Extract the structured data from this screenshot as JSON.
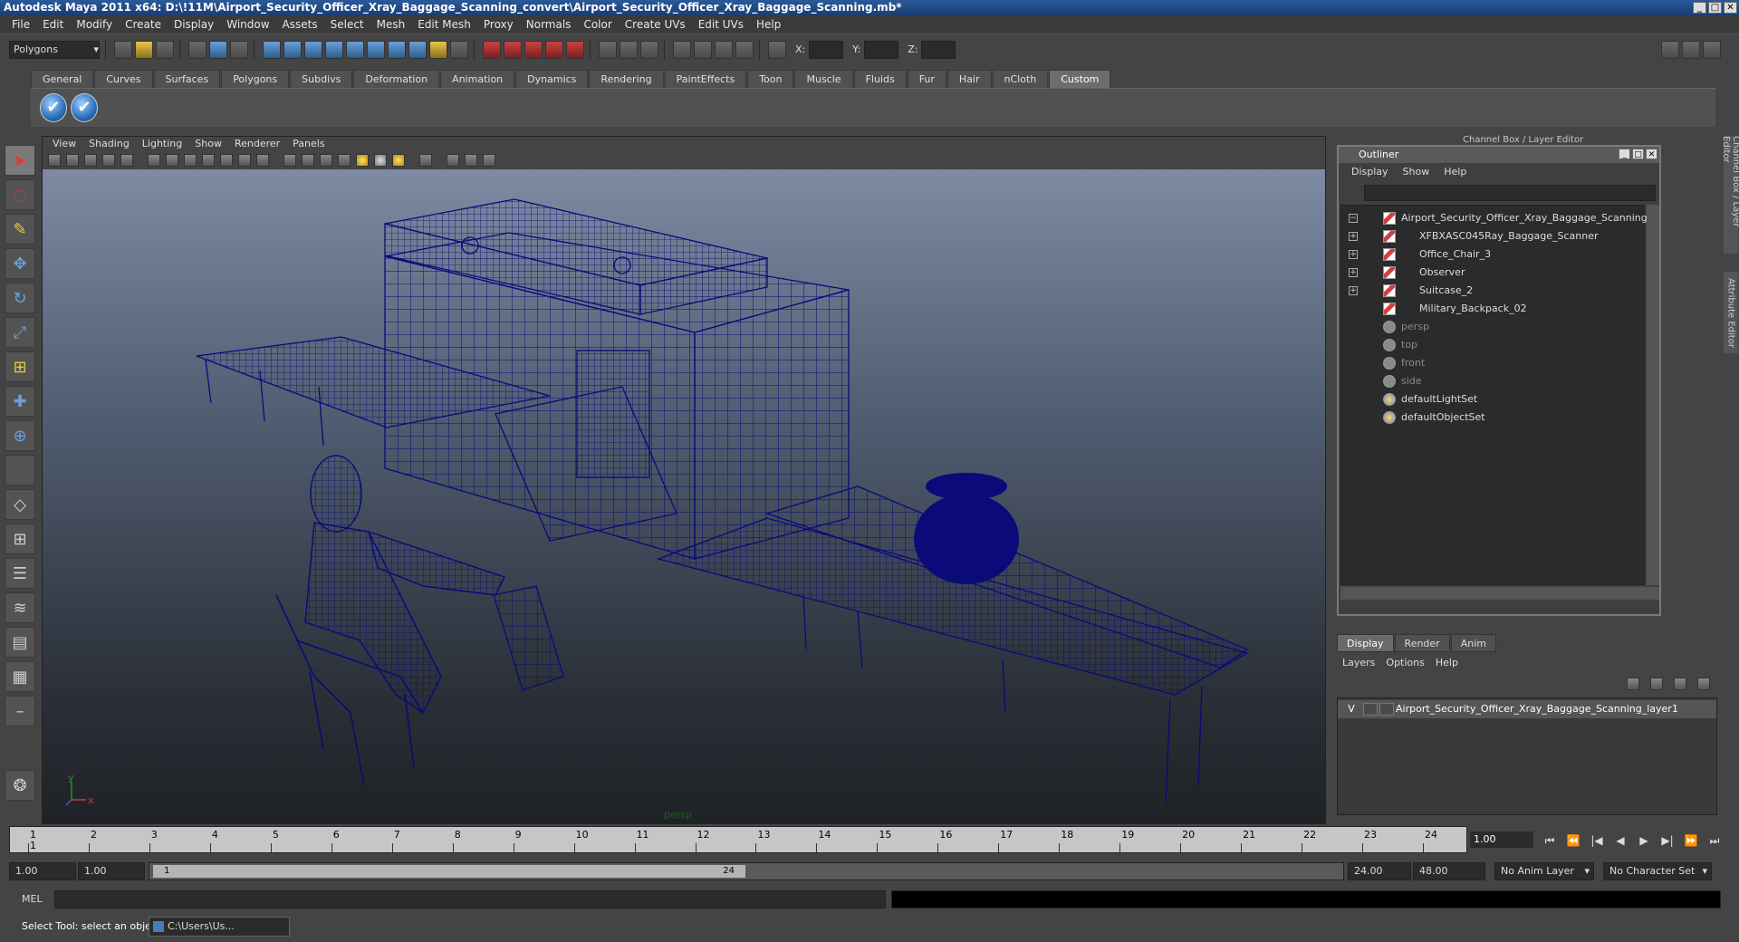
{
  "window": {
    "title": "Autodesk Maya 2011 x64: D:\\!11M\\Airport_Security_Officer_Xray_Baggage_Scanning_convert\\Airport_Security_Officer_Xray_Baggage_Scanning.mb*",
    "min_glyph": "_",
    "max_glyph": "□",
    "close_glyph": "✕"
  },
  "menubar": [
    "File",
    "Edit",
    "Modify",
    "Create",
    "Display",
    "Window",
    "Assets",
    "Select",
    "Mesh",
    "Edit Mesh",
    "Proxy",
    "Normals",
    "Color",
    "Create UVs",
    "Edit UVs",
    "Help"
  ],
  "statusline": {
    "mode": "Polygons",
    "x_label": "X:",
    "y_label": "Y:",
    "z_label": "Z:"
  },
  "shelf": {
    "tabs": [
      "General",
      "Curves",
      "Surfaces",
      "Polygons",
      "Subdivs",
      "Deformation",
      "Animation",
      "Dynamics",
      "Rendering",
      "PaintEffects",
      "Toon",
      "Muscle",
      "Fluids",
      "Fur",
      "Hair",
      "nCloth",
      "Custom"
    ],
    "active_tab": "Custom",
    "check_glyph": "✔"
  },
  "viewport": {
    "menu": [
      "View",
      "Shading",
      "Lighting",
      "Show",
      "Renderer",
      "Panels"
    ],
    "camera_label": "persp",
    "axis": {
      "y": "y",
      "x": "x"
    },
    "colors": {
      "wire": "#0a0a78",
      "grid_green": "#0a6a0a"
    }
  },
  "outliner": {
    "title": "Outliner",
    "menu": [
      "Display",
      "Show",
      "Help"
    ],
    "items": [
      {
        "label": "Airport_Security_Officer_Xray_Baggage_Scanning",
        "indent": 0,
        "icon": "mesh-icon",
        "expand": "−",
        "dim": false
      },
      {
        "label": "XFBXASC045Ray_Baggage_Scanner",
        "indent": 1,
        "icon": "mesh-icon",
        "expand": "+",
        "dim": false
      },
      {
        "label": "Office_Chair_3",
        "indent": 1,
        "icon": "mesh-icon",
        "expand": "+",
        "dim": false
      },
      {
        "label": "Observer",
        "indent": 1,
        "icon": "mesh-icon",
        "expand": "+",
        "dim": false
      },
      {
        "label": "Suitcase_2",
        "indent": 1,
        "icon": "mesh-icon",
        "expand": "+",
        "dim": false
      },
      {
        "label": "Military_Backpack_02",
        "indent": 1,
        "icon": "mesh-icon",
        "expand": "",
        "dim": false
      },
      {
        "label": "persp",
        "indent": 0,
        "icon": "camera-icon",
        "expand": "",
        "dim": true
      },
      {
        "label": "top",
        "indent": 0,
        "icon": "camera-icon",
        "expand": "",
        "dim": true
      },
      {
        "label": "front",
        "indent": 0,
        "icon": "camera-icon",
        "expand": "",
        "dim": true
      },
      {
        "label": "side",
        "indent": 0,
        "icon": "camera-icon",
        "expand": "",
        "dim": true
      },
      {
        "label": "defaultLightSet",
        "indent": 0,
        "icon": "set-icon",
        "expand": "",
        "dim": false
      },
      {
        "label": "defaultObjectSet",
        "indent": 0,
        "icon": "set-icon",
        "expand": "",
        "dim": false
      }
    ]
  },
  "channelbox": {
    "title": "Channel Box / Layer Editor",
    "vtabs": [
      "Channel Box / Layer Editor",
      "Attribute Editor"
    ]
  },
  "layer_editor": {
    "tabs": [
      "Display",
      "Render",
      "Anim"
    ],
    "active_tab": "Display",
    "menu": [
      "Layers",
      "Options",
      "Help"
    ],
    "layer": {
      "visible": "V",
      "name": "Airport_Security_Officer_Xray_Baggage_Scanning_layer1"
    }
  },
  "timeline": {
    "ticks": [
      "1",
      "2",
      "3",
      "4",
      "5",
      "6",
      "7",
      "8",
      "9",
      "10",
      "11",
      "12",
      "13",
      "14",
      "15",
      "16",
      "17",
      "18",
      "19",
      "20",
      "21",
      "22",
      "23",
      "24"
    ],
    "current_marker": "1",
    "current_frame": "1.00",
    "play_controls": [
      "⏮",
      "⏪",
      "|◀",
      "◀",
      "▶",
      "▶|",
      "⏩",
      "⏭"
    ]
  },
  "range": {
    "start": "1.00",
    "playback_start": "1.00",
    "slider_start": "1",
    "slider_end": "24",
    "playback_end": "24.00",
    "end": "48.00",
    "anim_layer": "No Anim Layer",
    "char_set": "No Character Set"
  },
  "cmdline": {
    "label": "MEL"
  },
  "helpline": {
    "text": "Select Tool: select an object",
    "task": "C:\\Users\\Us..."
  }
}
